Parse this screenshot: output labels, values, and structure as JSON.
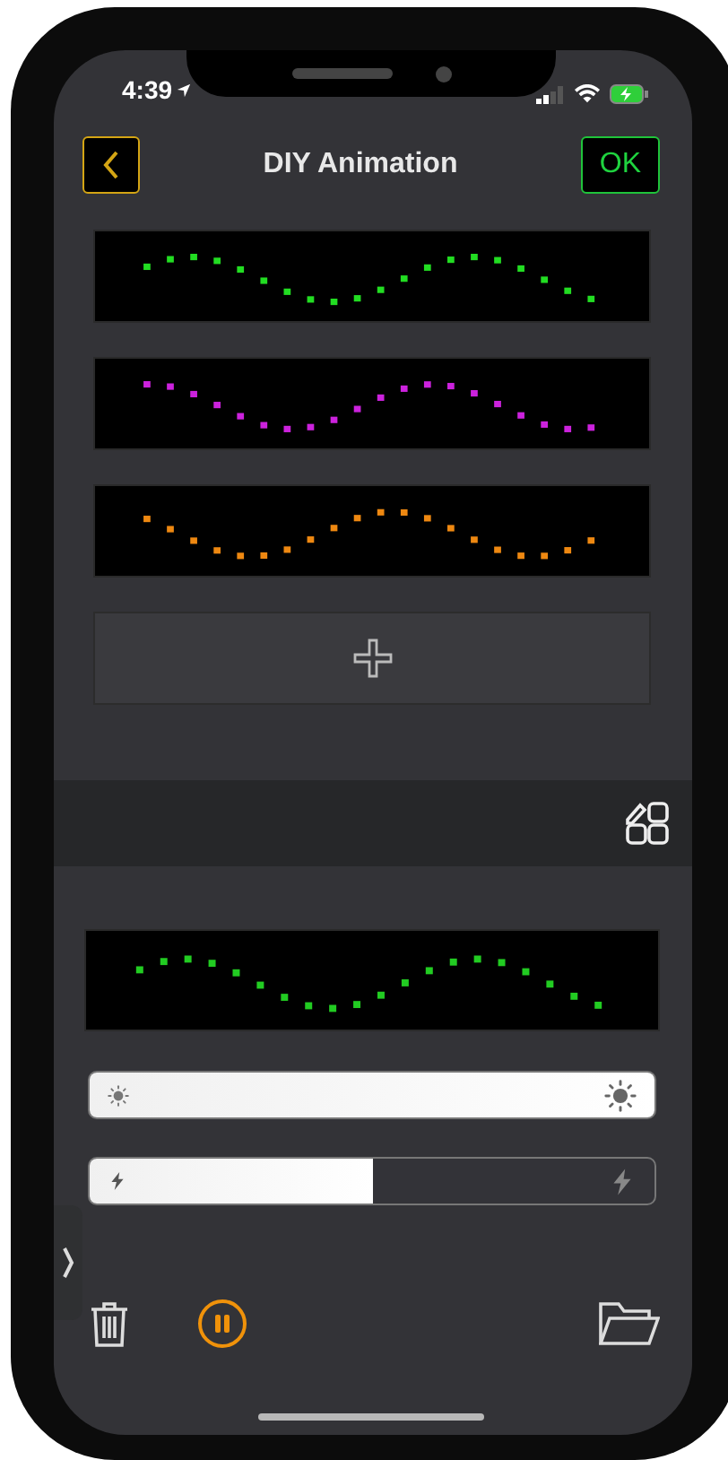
{
  "status_bar": {
    "time": "4:39"
  },
  "nav": {
    "title": "DIY Animation",
    "ok_label": "OK"
  },
  "frames": [
    {
      "color": "#22dd22"
    },
    {
      "color": "#cc22dd"
    },
    {
      "color": "#ee8811"
    }
  ],
  "preview": {
    "color": "#22cc22"
  },
  "brightness": {
    "level": 1.0
  },
  "speed": {
    "level": 0.5
  },
  "playing": true
}
